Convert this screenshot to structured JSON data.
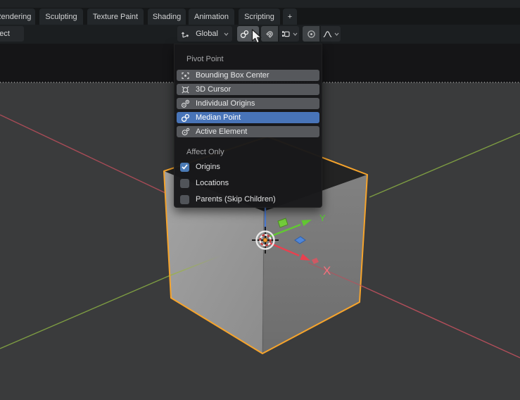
{
  "tabs": {
    "items": [
      "Rendering",
      "Sculpting",
      "Texture Paint",
      "Shading",
      "Animation",
      "Scripting"
    ],
    "add_label": "+"
  },
  "header": {
    "mode_label": "Object",
    "orientation_value": "Global",
    "icons": [
      "orientation-global-icon",
      "pivot-point-icon",
      "magnet-icon",
      "snap-with-icon",
      "proportional-editing-icon",
      "falloff-curve-icon"
    ]
  },
  "menu": {
    "title": "Pivot Point",
    "items": [
      {
        "label": "Bounding Box Center",
        "icon": "bounding-box-center-icon",
        "selected": false
      },
      {
        "label": "3D Cursor",
        "icon": "cursor-3d-icon",
        "selected": false
      },
      {
        "label": "Individual Origins",
        "icon": "individual-origins-icon",
        "selected": false
      },
      {
        "label": "Median Point",
        "icon": "median-point-icon",
        "selected": true
      },
      {
        "label": "Active Element",
        "icon": "active-element-icon",
        "selected": false
      }
    ],
    "affect_title": "Affect Only",
    "checks": [
      {
        "label": "Origins",
        "checked": true
      },
      {
        "label": "Locations",
        "checked": false
      },
      {
        "label": "Parents (Skip Children)",
        "checked": false
      }
    ]
  },
  "viewport": {
    "axis_x_label": "X",
    "axis_y_label": "Y"
  },
  "colors": {
    "accent_blue": "#4874b8",
    "checkbox_blue": "#4a7ab5",
    "selection_orange": "#f6a42c",
    "axis_x_red": "#e8414f",
    "axis_y_green": "#62c832",
    "axis_z_blue": "#4a79cf",
    "grid_red": "#a64b56",
    "grid_green": "#7d9c42",
    "viewport_bg": "#3a3b3c"
  }
}
